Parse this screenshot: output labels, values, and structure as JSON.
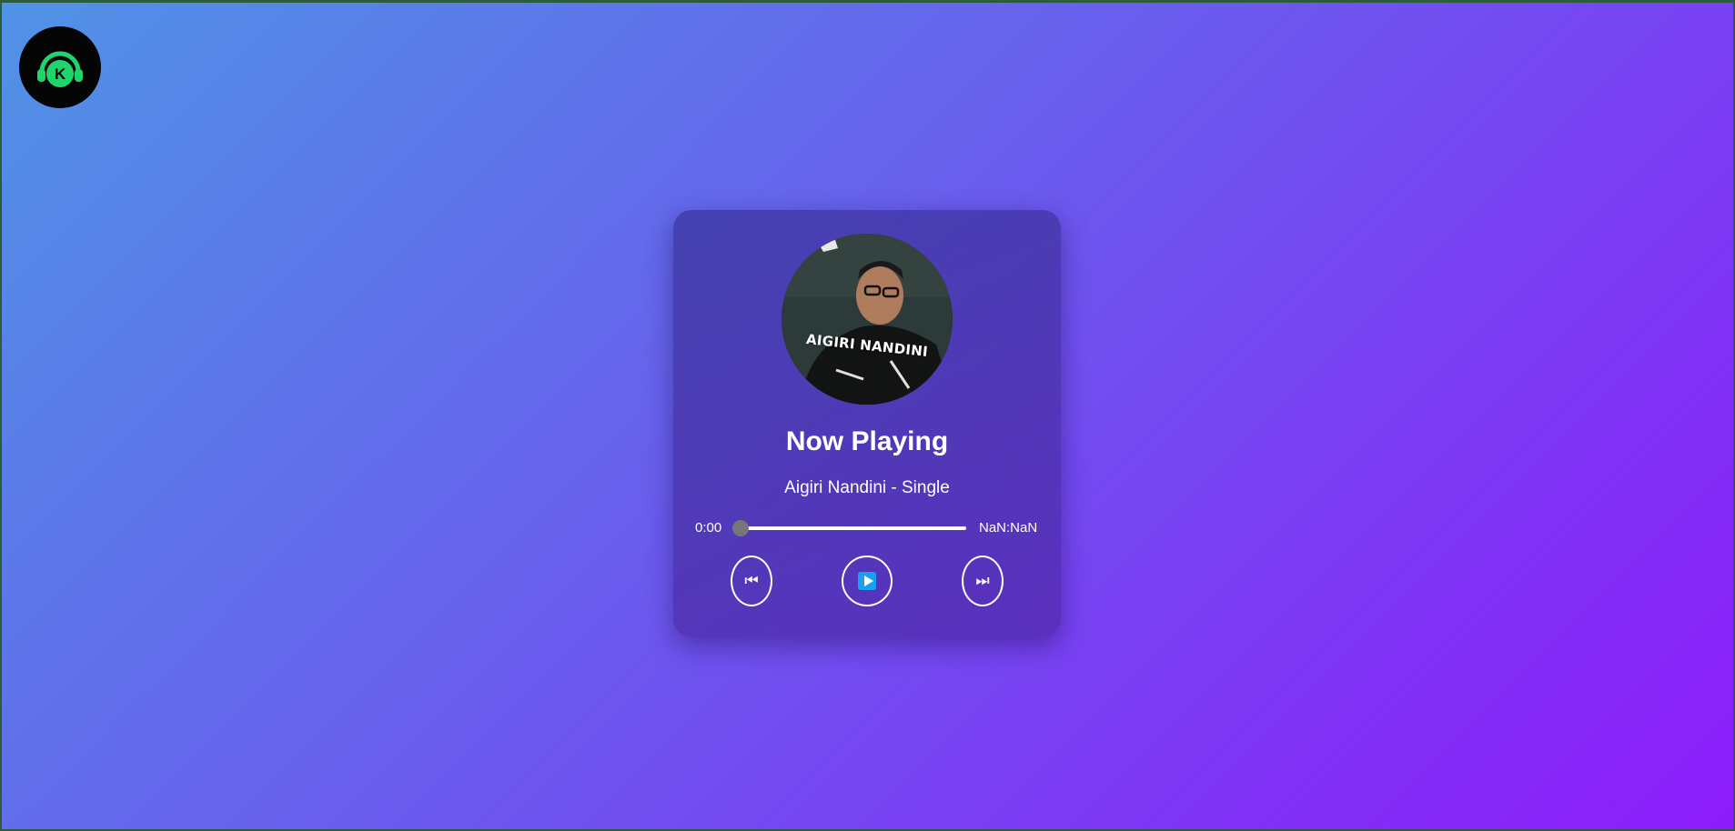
{
  "logo": {
    "letter": "K",
    "icon": "headphones-icon",
    "accent": "#1fd46a"
  },
  "player": {
    "album_art_text": "AIGIRI NANDINI",
    "title": "Now Playing",
    "track_name": "Aigiri Nandini - Single",
    "current_time": "0:00",
    "duration": "NaN:NaN",
    "progress": 0,
    "controls": {
      "previous": "⏮",
      "next": "⏭"
    }
  }
}
